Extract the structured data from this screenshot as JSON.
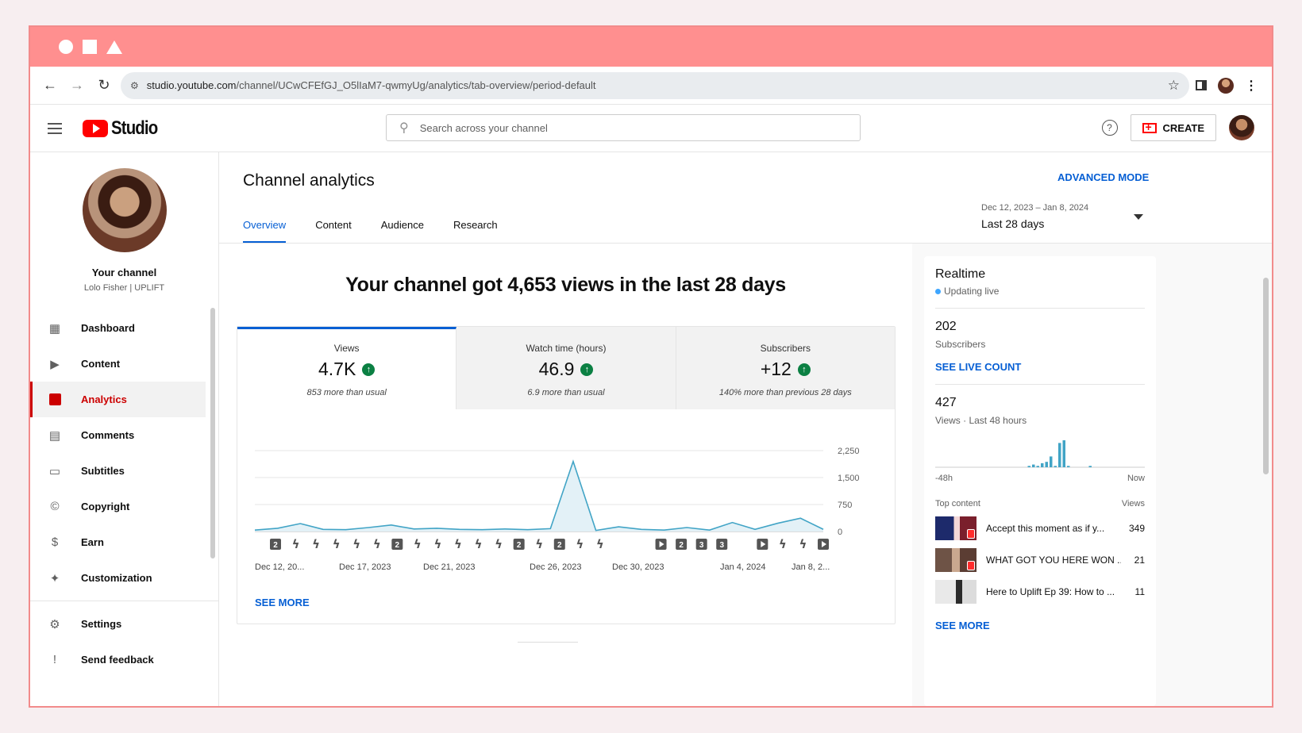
{
  "browser": {
    "url_host": "studio.youtube.com",
    "url_path": "/channel/UCwCFEfGJ_O5lIaM7-qwmyUg/analytics/tab-overview/period-default"
  },
  "header": {
    "logo_text": "Studio",
    "search_placeholder": "Search across your channel",
    "create_label": "CREATE"
  },
  "sidebar": {
    "channel_label": "Your channel",
    "channel_name": "Lolo Fisher | UPLIFT",
    "items": [
      {
        "label": "Dashboard",
        "icon": "dashboard-icon"
      },
      {
        "label": "Content",
        "icon": "content-icon"
      },
      {
        "label": "Analytics",
        "icon": "analytics-icon"
      },
      {
        "label": "Comments",
        "icon": "comments-icon"
      },
      {
        "label": "Subtitles",
        "icon": "subtitles-icon"
      },
      {
        "label": "Copyright",
        "icon": "copyright-icon"
      },
      {
        "label": "Earn",
        "icon": "earn-icon"
      },
      {
        "label": "Customization",
        "icon": "customization-icon"
      }
    ],
    "bottom_items": [
      {
        "label": "Settings",
        "icon": "settings-icon"
      },
      {
        "label": "Send feedback",
        "icon": "feedback-icon"
      }
    ]
  },
  "main": {
    "title": "Channel analytics",
    "advanced_mode": "ADVANCED MODE",
    "tabs": [
      "Overview",
      "Content",
      "Audience",
      "Research"
    ],
    "active_tab": "Overview",
    "period_range": "Dec 12, 2023 – Jan 8, 2024",
    "period_label": "Last 28 days",
    "headline": "Your channel got 4,653 views in the last 28 days",
    "metrics": [
      {
        "label": "Views",
        "value": "4.7K",
        "note": "853 more than usual"
      },
      {
        "label": "Watch time (hours)",
        "value": "46.9",
        "note": "6.9 more than usual"
      },
      {
        "label": "Subscribers",
        "value": "+12",
        "note": "140% more than previous 28 days"
      }
    ],
    "see_more": "SEE MORE"
  },
  "chart_data": {
    "type": "line",
    "series_color": "#41a4c6",
    "x_labels": [
      "Dec 12, 20...",
      "Dec 17, 2023",
      "Dec 21, 2023",
      "Dec 26, 2023",
      "Dec 30, 2023",
      "Jan 4, 2024",
      "Jan 8, 2..."
    ],
    "y_ticks": [
      "2,250",
      "1,500",
      "750",
      "0"
    ],
    "ylim": [
      0,
      2250
    ],
    "values": [
      40,
      90,
      220,
      60,
      50,
      110,
      180,
      70,
      90,
      60,
      50,
      70,
      50,
      80,
      1950,
      30,
      130,
      60,
      40,
      110,
      40,
      250,
      60,
      230,
      370,
      60
    ],
    "markers": [
      "2",
      "s",
      "s",
      "s",
      "s",
      "s",
      "2",
      "s",
      "s",
      "s",
      "s",
      "s",
      "2",
      "s",
      "2",
      "s",
      "s",
      "",
      "",
      "p",
      "2",
      "3",
      "3",
      "",
      "p",
      "s",
      "s",
      "p"
    ]
  },
  "realtime": {
    "title": "Realtime",
    "live_label": "Updating live",
    "subscribers_count": "202",
    "subscribers_label": "Subscribers",
    "see_live_count": "SEE LIVE COUNT",
    "views_count": "427",
    "views_label": "Views · Last 48 hours",
    "axis_start": "-48h",
    "axis_end": "Now",
    "top_content_label": "Top content",
    "views_col": "Views",
    "top_content": [
      {
        "title": "Accept this moment as if y...",
        "views": "349"
      },
      {
        "title": "WHAT GOT YOU HERE WON ...",
        "views": "21"
      },
      {
        "title": "Here to Uplift Ep 39: How to ...",
        "views": "11"
      }
    ],
    "see_more": "SEE MORE",
    "bars_48h": [
      0,
      0,
      0,
      0,
      0,
      0,
      0,
      0,
      0,
      0,
      0,
      0,
      0,
      0,
      0,
      0,
      0,
      0,
      0,
      0,
      0,
      1,
      2,
      1,
      3,
      4,
      8,
      1,
      18,
      20,
      1,
      0,
      0,
      0,
      0,
      1,
      0,
      0,
      0,
      0,
      0,
      0,
      0,
      0,
      0,
      0,
      0,
      0
    ]
  }
}
